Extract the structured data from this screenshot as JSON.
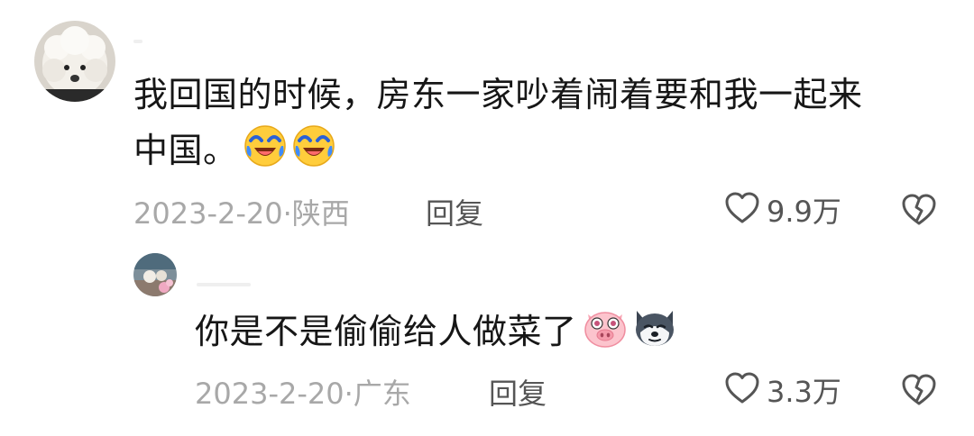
{
  "comments": [
    {
      "text_line1": "我回国的时候，房东一家吵着闹着要和我一起来",
      "text_line2": "中国。",
      "emojis": [
        "laugh-cry-emoji",
        "laugh-cry-emoji"
      ],
      "date": "2023-2-20",
      "location": "陕西",
      "reply_label": "回复",
      "likes": "9.9万"
    },
    {
      "text": "你是不是偷偷给人做菜了",
      "emojis": [
        "pig-face-emoji",
        "husky-emoji"
      ],
      "date": "2023-2-20",
      "location": "广东",
      "reply_label": "回复",
      "likes": "3.3万"
    }
  ],
  "separator": "·"
}
